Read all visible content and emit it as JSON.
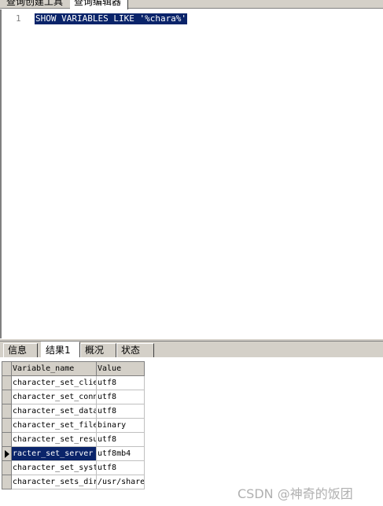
{
  "top_tabs": [
    "查询创建工具",
    "查询编辑器"
  ],
  "editor": {
    "line_number": "1",
    "code": "SHOW VARIABLES LIKE '%chara%'"
  },
  "bottom_tabs": [
    "信息",
    "结果1",
    "概况",
    "状态"
  ],
  "result": {
    "columns": [
      "Variable_name",
      "Value"
    ],
    "rows": [
      {
        "name": "character_set_clie",
        "value": "utf8"
      },
      {
        "name": "character_set_conn",
        "value": "utf8"
      },
      {
        "name": "character_set_data",
        "value": "utf8"
      },
      {
        "name": "character_set_file",
        "value": "binary"
      },
      {
        "name": "character_set_resu",
        "value": "utf8"
      },
      {
        "name": "racter_set_server",
        "value": "utf8mb4"
      },
      {
        "name": "character_set_syst",
        "value": "utf8"
      },
      {
        "name": "character_sets_dir",
        "value": "/usr/share"
      }
    ]
  },
  "watermark": "CSDN @神奇的饭团",
  "colors": {
    "selection": "#0a246a",
    "chrome": "#d4d0c8"
  }
}
